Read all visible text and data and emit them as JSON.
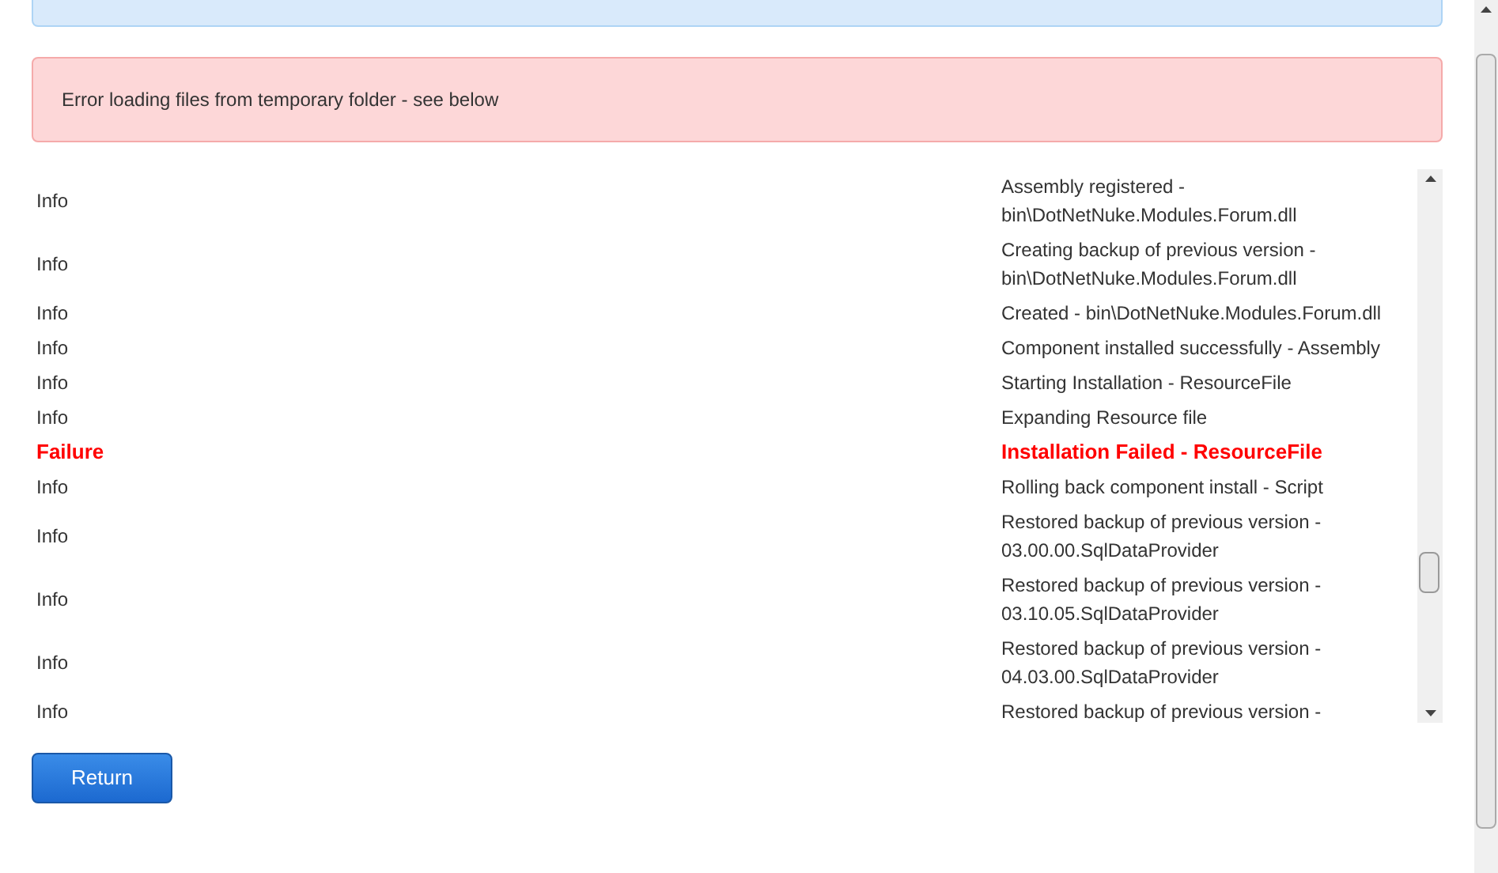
{
  "error_message": "Error loading files from temporary folder - see below",
  "log": [
    {
      "kind": "info",
      "level": "Info",
      "message": "Assembly registered - bin\\DotNetNuke.Modules.Forum.dll"
    },
    {
      "kind": "info",
      "level": "Info",
      "message": "Creating backup of previous version - bin\\DotNetNuke.Modules.Forum.dll"
    },
    {
      "kind": "info",
      "level": "Info",
      "message": "Created - bin\\DotNetNuke.Modules.Forum.dll"
    },
    {
      "kind": "info",
      "level": "Info",
      "message": "Component installed successfully - Assembly"
    },
    {
      "kind": "info",
      "level": "Info",
      "message": "Starting Installation - ResourceFile"
    },
    {
      "kind": "info",
      "level": "Info",
      "message": "Expanding Resource file"
    },
    {
      "kind": "failure",
      "level": "Failure",
      "message": "Installation Failed - ResourceFile"
    },
    {
      "kind": "info",
      "level": "Info",
      "message": "Rolling back component install - Script"
    },
    {
      "kind": "info",
      "level": "Info",
      "message": "Restored backup of previous version - 03.00.00.SqlDataProvider"
    },
    {
      "kind": "info",
      "level": "Info",
      "message": "Restored backup of previous version - 03.10.05.SqlDataProvider"
    },
    {
      "kind": "info",
      "level": "Info",
      "message": "Restored backup of previous version - 04.03.00.SqlDataProvider"
    },
    {
      "kind": "info",
      "level": "Info",
      "message": "Restored backup of previous version -"
    }
  ],
  "return_button": "Return"
}
